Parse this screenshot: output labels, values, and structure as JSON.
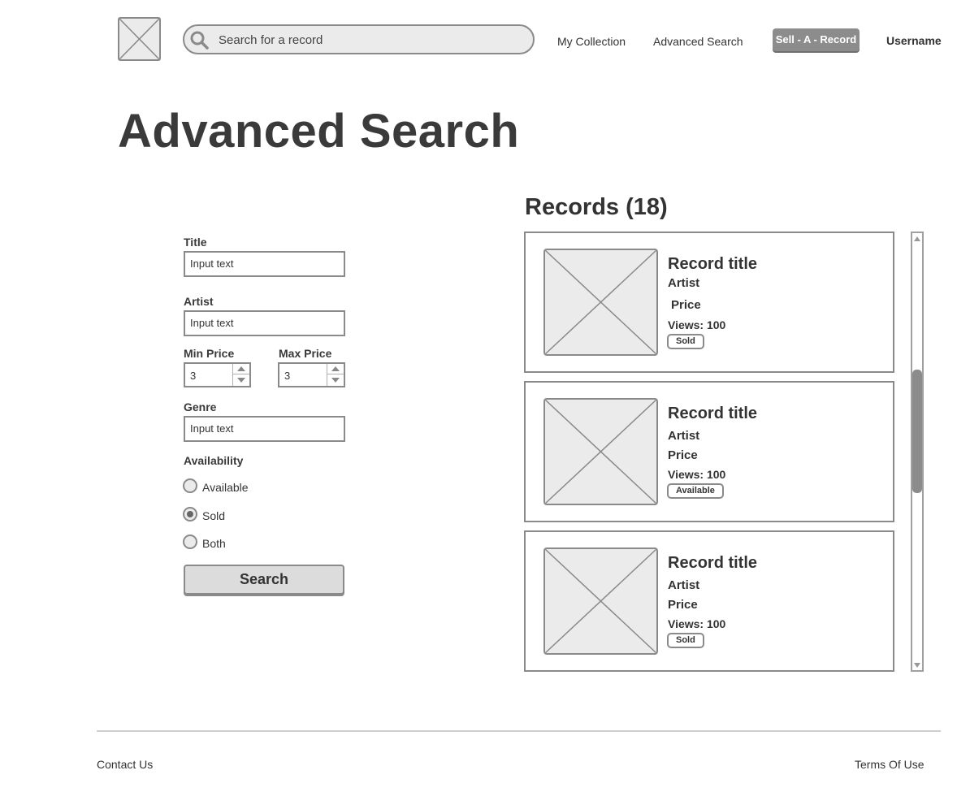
{
  "header": {
    "logo_icon": "image-placeholder-icon",
    "search_placeholder": "Search for a record",
    "nav_my_collection": "My Collection",
    "nav_advanced_search": "Advanced Search",
    "sell_button": "Sell - A - Record",
    "username": "Username"
  },
  "page": {
    "title": "Advanced Search"
  },
  "form": {
    "title_label": "Title",
    "title_value": "Input text",
    "artist_label": "Artist",
    "artist_value": "Input text",
    "min_price_label": "Min Price",
    "min_price_value": "3",
    "max_price_label": "Max Price",
    "max_price_value": "3",
    "genre_label": "Genre",
    "genre_value": "Input text",
    "availability_label": "Availability",
    "availability_options": [
      "Available",
      "Sold",
      "Both"
    ],
    "availability_selected": "Sold",
    "search_button": "Search"
  },
  "records": {
    "heading": "Records (18)",
    "items": [
      {
        "title": "Record title",
        "artist": "Artist",
        "price": "Price",
        "views": "Views: 100",
        "status": "Sold"
      },
      {
        "title": "Record title",
        "artist": "Artist",
        "price": "Price",
        "views": "Views: 100",
        "status": "Available"
      },
      {
        "title": "Record title",
        "artist": "Artist",
        "price": "Price",
        "views": "Views: 100",
        "status": "Sold"
      }
    ]
  },
  "footer": {
    "contact": "Contact Us",
    "terms": "Terms Of Use"
  },
  "colors": {
    "accent_gray": "#8c8c8c",
    "border_gray": "#8a8a8a",
    "placeholder_fill": "#ebebeb"
  }
}
